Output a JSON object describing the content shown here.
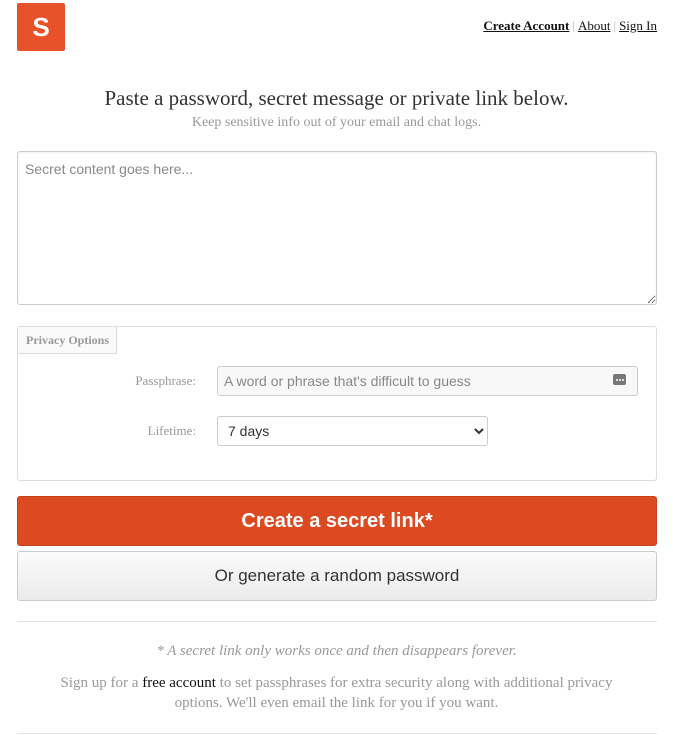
{
  "logo": {
    "letter": "S",
    "color": "#e8522a"
  },
  "nav": {
    "create_account": "Create Account",
    "about": "About",
    "sign_in": "Sign In",
    "separator": "|"
  },
  "header": {
    "title": "Paste a password, secret message or private link below.",
    "subtitle": "Keep sensitive info out of your email and chat logs."
  },
  "secret": {
    "placeholder": "Secret content goes here...",
    "value": ""
  },
  "privacy": {
    "tab_label": "Privacy Options",
    "passphrase_label": "Passphrase:",
    "passphrase_placeholder": "A word or phrase that's difficult to guess",
    "passphrase_icon": "dots-icon",
    "lifetime_label": "Lifetime:",
    "lifetime_selected": "7 days"
  },
  "buttons": {
    "create": "Create a secret link*",
    "create_color": "#dc4a22",
    "generate": "Or generate a random password"
  },
  "footer": {
    "note": "* A secret link only works once and then disappears forever.",
    "signup_prefix": "Sign up for a",
    "signup_link": "free account",
    "signup_suffix": "to set passphrases for extra security along with additional privacy options. We'll even email the link for you if you want."
  }
}
